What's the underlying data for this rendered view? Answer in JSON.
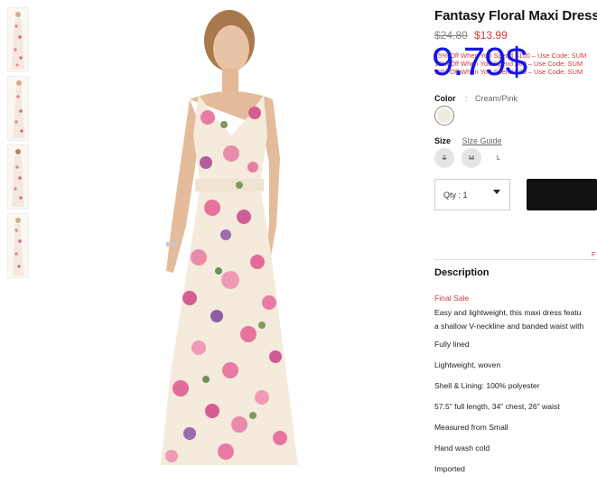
{
  "product": {
    "title": "Fantasy Floral Maxi Dress",
    "old_price": "$24.80",
    "sale_price": "$13.99",
    "overlay_price": "9.79$",
    "promos": [
      "15% Off When You Spend $100 – Use Code: SUM",
      "10% Off When You Spend $60 – Use Code: SUM",
      "10% Off When You Spend $30 – Use Code: SUM"
    ],
    "color_label": "Color",
    "color_sep": ":",
    "color_value": "Cream/Pink",
    "swatch_color": "#efebe1",
    "size_label": "Size",
    "size_guide": "Size Guide",
    "sizes": [
      "S",
      "M",
      "L"
    ],
    "qty_label": "Qty : 1",
    "side_fragment": "F"
  },
  "description": {
    "title": "Description",
    "final_sale": "Final Sale",
    "intro_1": "Easy and lightweight, this maxi dress featu",
    "intro_2": "a shallow V-neckline and banded waist with",
    "bullets": [
      "Fully lined",
      "Lightweight, woven",
      "Shell & Lining: 100% polyester",
      "57.5\" full length, 34\" chest, 26\" waist",
      "Measured from Small",
      "Hand wash cold",
      "Imported"
    ]
  },
  "colors": {
    "sale_red": "#d23b3b",
    "overlay_blue": "#1616e6",
    "button_black": "#111111"
  }
}
